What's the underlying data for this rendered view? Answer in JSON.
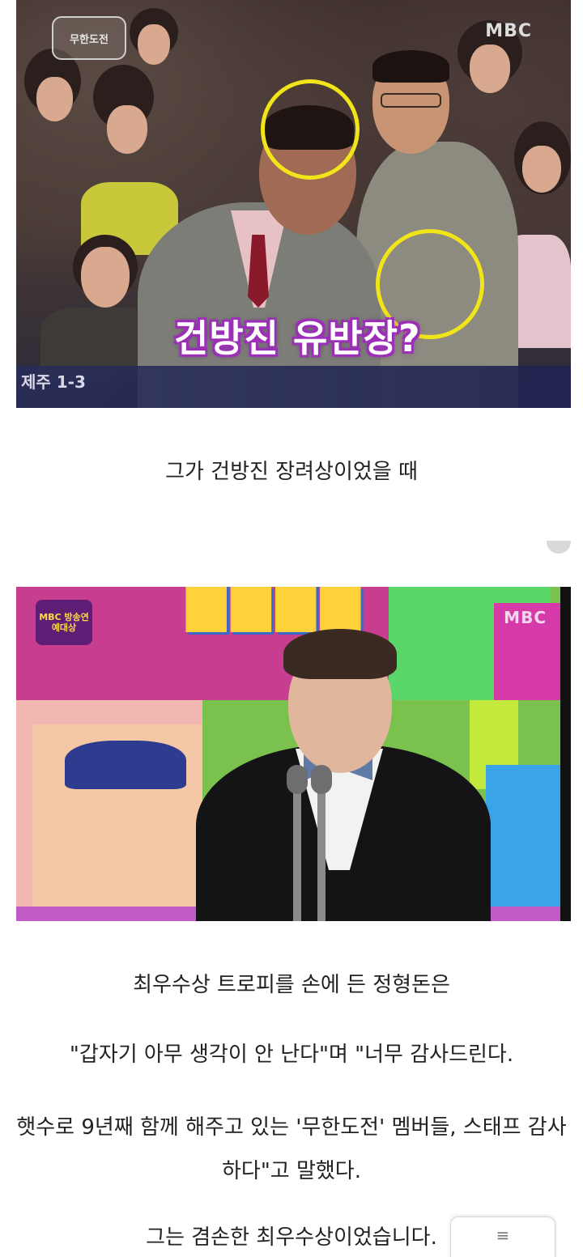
{
  "image1": {
    "caption": "건방진 유반장?",
    "region_label": "제주 1-3",
    "broadcaster": "MBC",
    "show_logo": "무한도전",
    "highlight_color": "#f1e51a"
  },
  "paragraphs": {
    "p1": "그가 건방진 장려상이었을 때",
    "p2": "최우수상 트로피를 손에 든 정형돈은",
    "p3": "\"갑자기 아무 생각이 안 난다\"며 \"너무 감사드린다.",
    "p4": "햇수로 9년째 함께 해주고 있는 '무한도전' 멤버들, 스태프 감사하다\"고 말했다.",
    "p5": "그는 겸손한 최우수상이었습니다."
  },
  "image2": {
    "broadcaster": "MBC",
    "show_logo": "MBC 방송연예대상"
  },
  "menu": {
    "icon": "menu-icon",
    "glyph": "≡"
  }
}
